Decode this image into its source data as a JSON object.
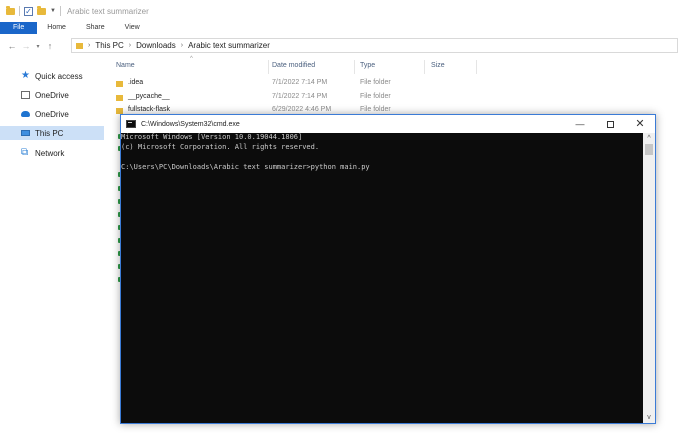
{
  "explorer": {
    "window_title": "Arabic text summarizer",
    "ribbon_tabs": [
      "File",
      "Home",
      "Share",
      "View"
    ],
    "breadcrumb": [
      "This PC",
      "Downloads",
      "Arabic text summarizer"
    ],
    "nav_pane": [
      "Quick access",
      "OneDrive",
      "OneDrive",
      "This PC",
      "Network"
    ],
    "columns": {
      "name": "Name",
      "date": "Date modified",
      "type": "Type",
      "size": "Size"
    },
    "files": [
      {
        "name": ".idea",
        "date": "7/1/2022 7:14 PM",
        "type": "File folder"
      },
      {
        "name": "__pycache__",
        "date": "7/1/2022 7:14 PM",
        "type": "File folder"
      },
      {
        "name": "fullstack-flask",
        "date": "6/29/2022 4:46 PM",
        "type": "File folder"
      }
    ]
  },
  "cmd": {
    "title": "C:\\Windows\\System32\\cmd.exe",
    "lines": [
      "Microsoft Windows [Version 10.0.19044.1806]",
      "(c) Microsoft Corporation. All rights reserved.",
      "",
      "C:\\Users\\PC\\Downloads\\Arabic text summarizer>python main.py"
    ],
    "min_glyph": "—",
    "close_glyph": "✕"
  },
  "colors": {
    "accent": "#1a66c9",
    "selection": "#cce0f7",
    "console_bg": "#0c0c0c",
    "console_fg": "#cccccc"
  }
}
